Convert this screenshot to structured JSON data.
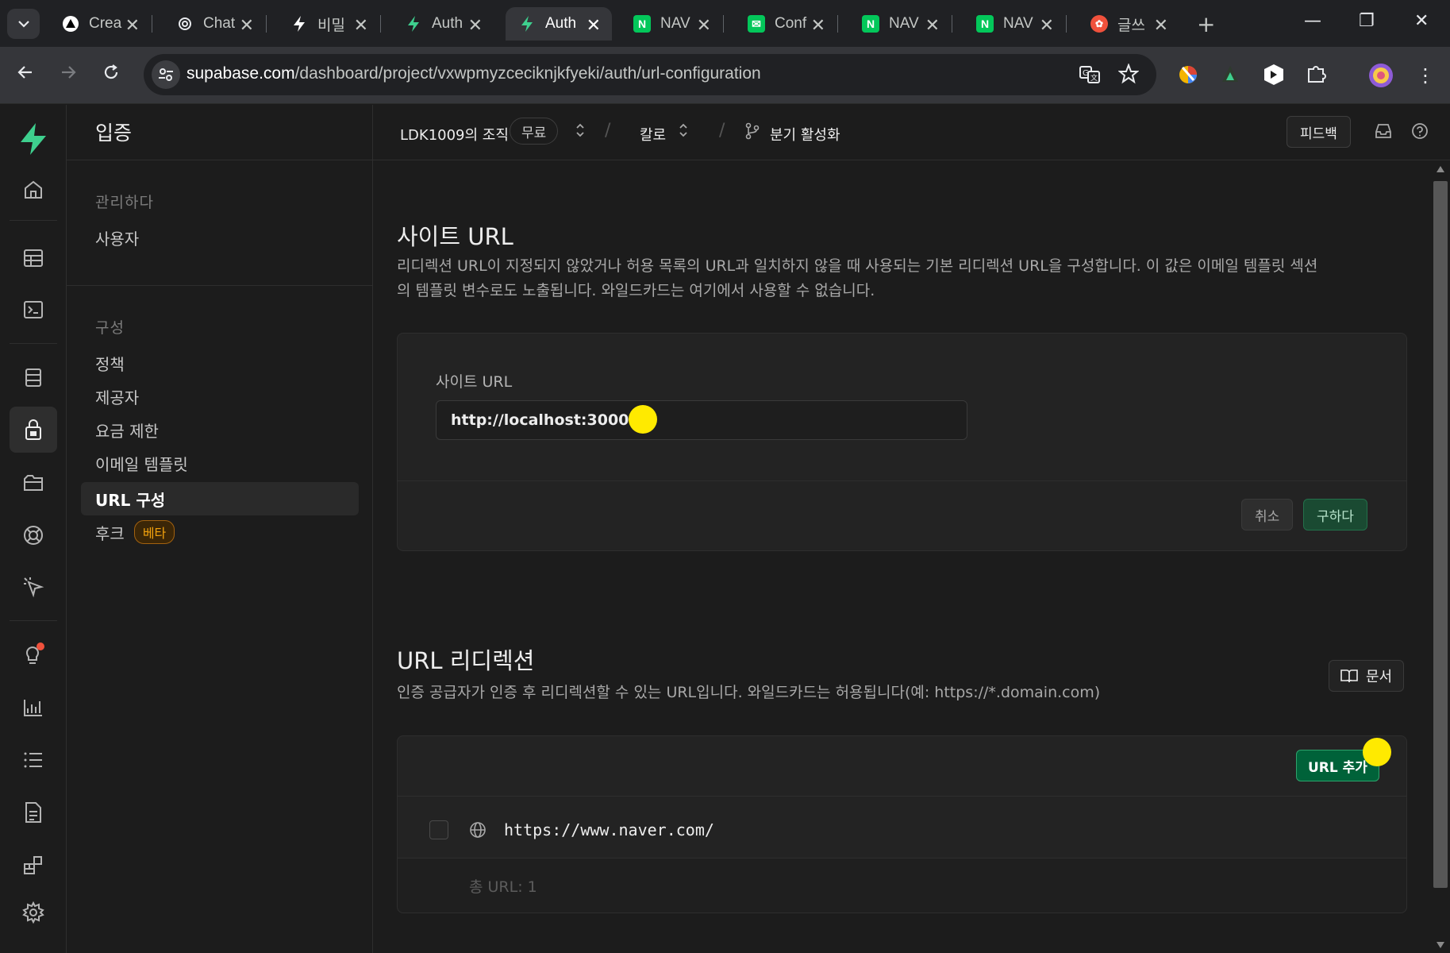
{
  "browser": {
    "tabs": [
      {
        "title": "Crea",
        "icon": "triangle-icon"
      },
      {
        "title": "Chat",
        "icon": "openai-icon"
      },
      {
        "title": "비밀",
        "icon": "bolt-icon"
      },
      {
        "title": "Auth",
        "icon": "supabase-icon"
      },
      {
        "title": "Auth",
        "icon": "supabase-icon"
      },
      {
        "title": "NAV",
        "icon": "naver-icon"
      },
      {
        "title": "Conf",
        "icon": "mail-icon"
      },
      {
        "title": "NAV",
        "icon": "naver-icon"
      },
      {
        "title": "NAV",
        "icon": "naver-icon"
      },
      {
        "title": "글쓰",
        "icon": "threads-icon"
      }
    ],
    "url_host": "supabase.com",
    "url_path": "/dashboard/project/vxwpmyzceciknjkfyeki/auth/url-configuration"
  },
  "topbar": {
    "org": "LDK1009의 조직",
    "plan": "무료",
    "project": "칼로",
    "branch": "분기 활성화",
    "feedback": "피드백"
  },
  "sidemenu": {
    "title": "입증",
    "section_manage": "관리하다",
    "users": "사용자",
    "section_config": "구성",
    "items": [
      "정책",
      "제공자",
      "요금 제한",
      "이메일 템플릿",
      "URL 구성",
      "후크"
    ],
    "beta": "베타"
  },
  "site_url": {
    "heading": "사이트 URL",
    "description_line1": "리디렉션 URL이 지정되지 않았거나 허용 목록의 URL과 일치하지 않을 때 사용되는 기본 리디렉션 URL을 구성합니다. 이 값은 이메일 템플릿 섹션",
    "description_line2": "의 템플릿 변수로도 노출됩니다. 와일드카드는 여기에서 사용할 수 없습니다.",
    "field_label": "사이트 URL",
    "value": "http://localhost:3000",
    "cancel": "취소",
    "save": "구하다"
  },
  "redirects": {
    "heading": "URL 리디렉션",
    "description": "인증 공급자가 인증 후 리디렉션할 수 있는 URL입니다. 와일드카드는 허용됩니다(예: https://*.domain.com)",
    "docs": "문서",
    "add": "URL 추가",
    "urls": [
      "https://www.naver.com/"
    ],
    "total": "총 URL: 1"
  },
  "colors": {
    "brand": "#3ecf8e",
    "accent_button": "#006239",
    "background": "#1c1c1c"
  }
}
